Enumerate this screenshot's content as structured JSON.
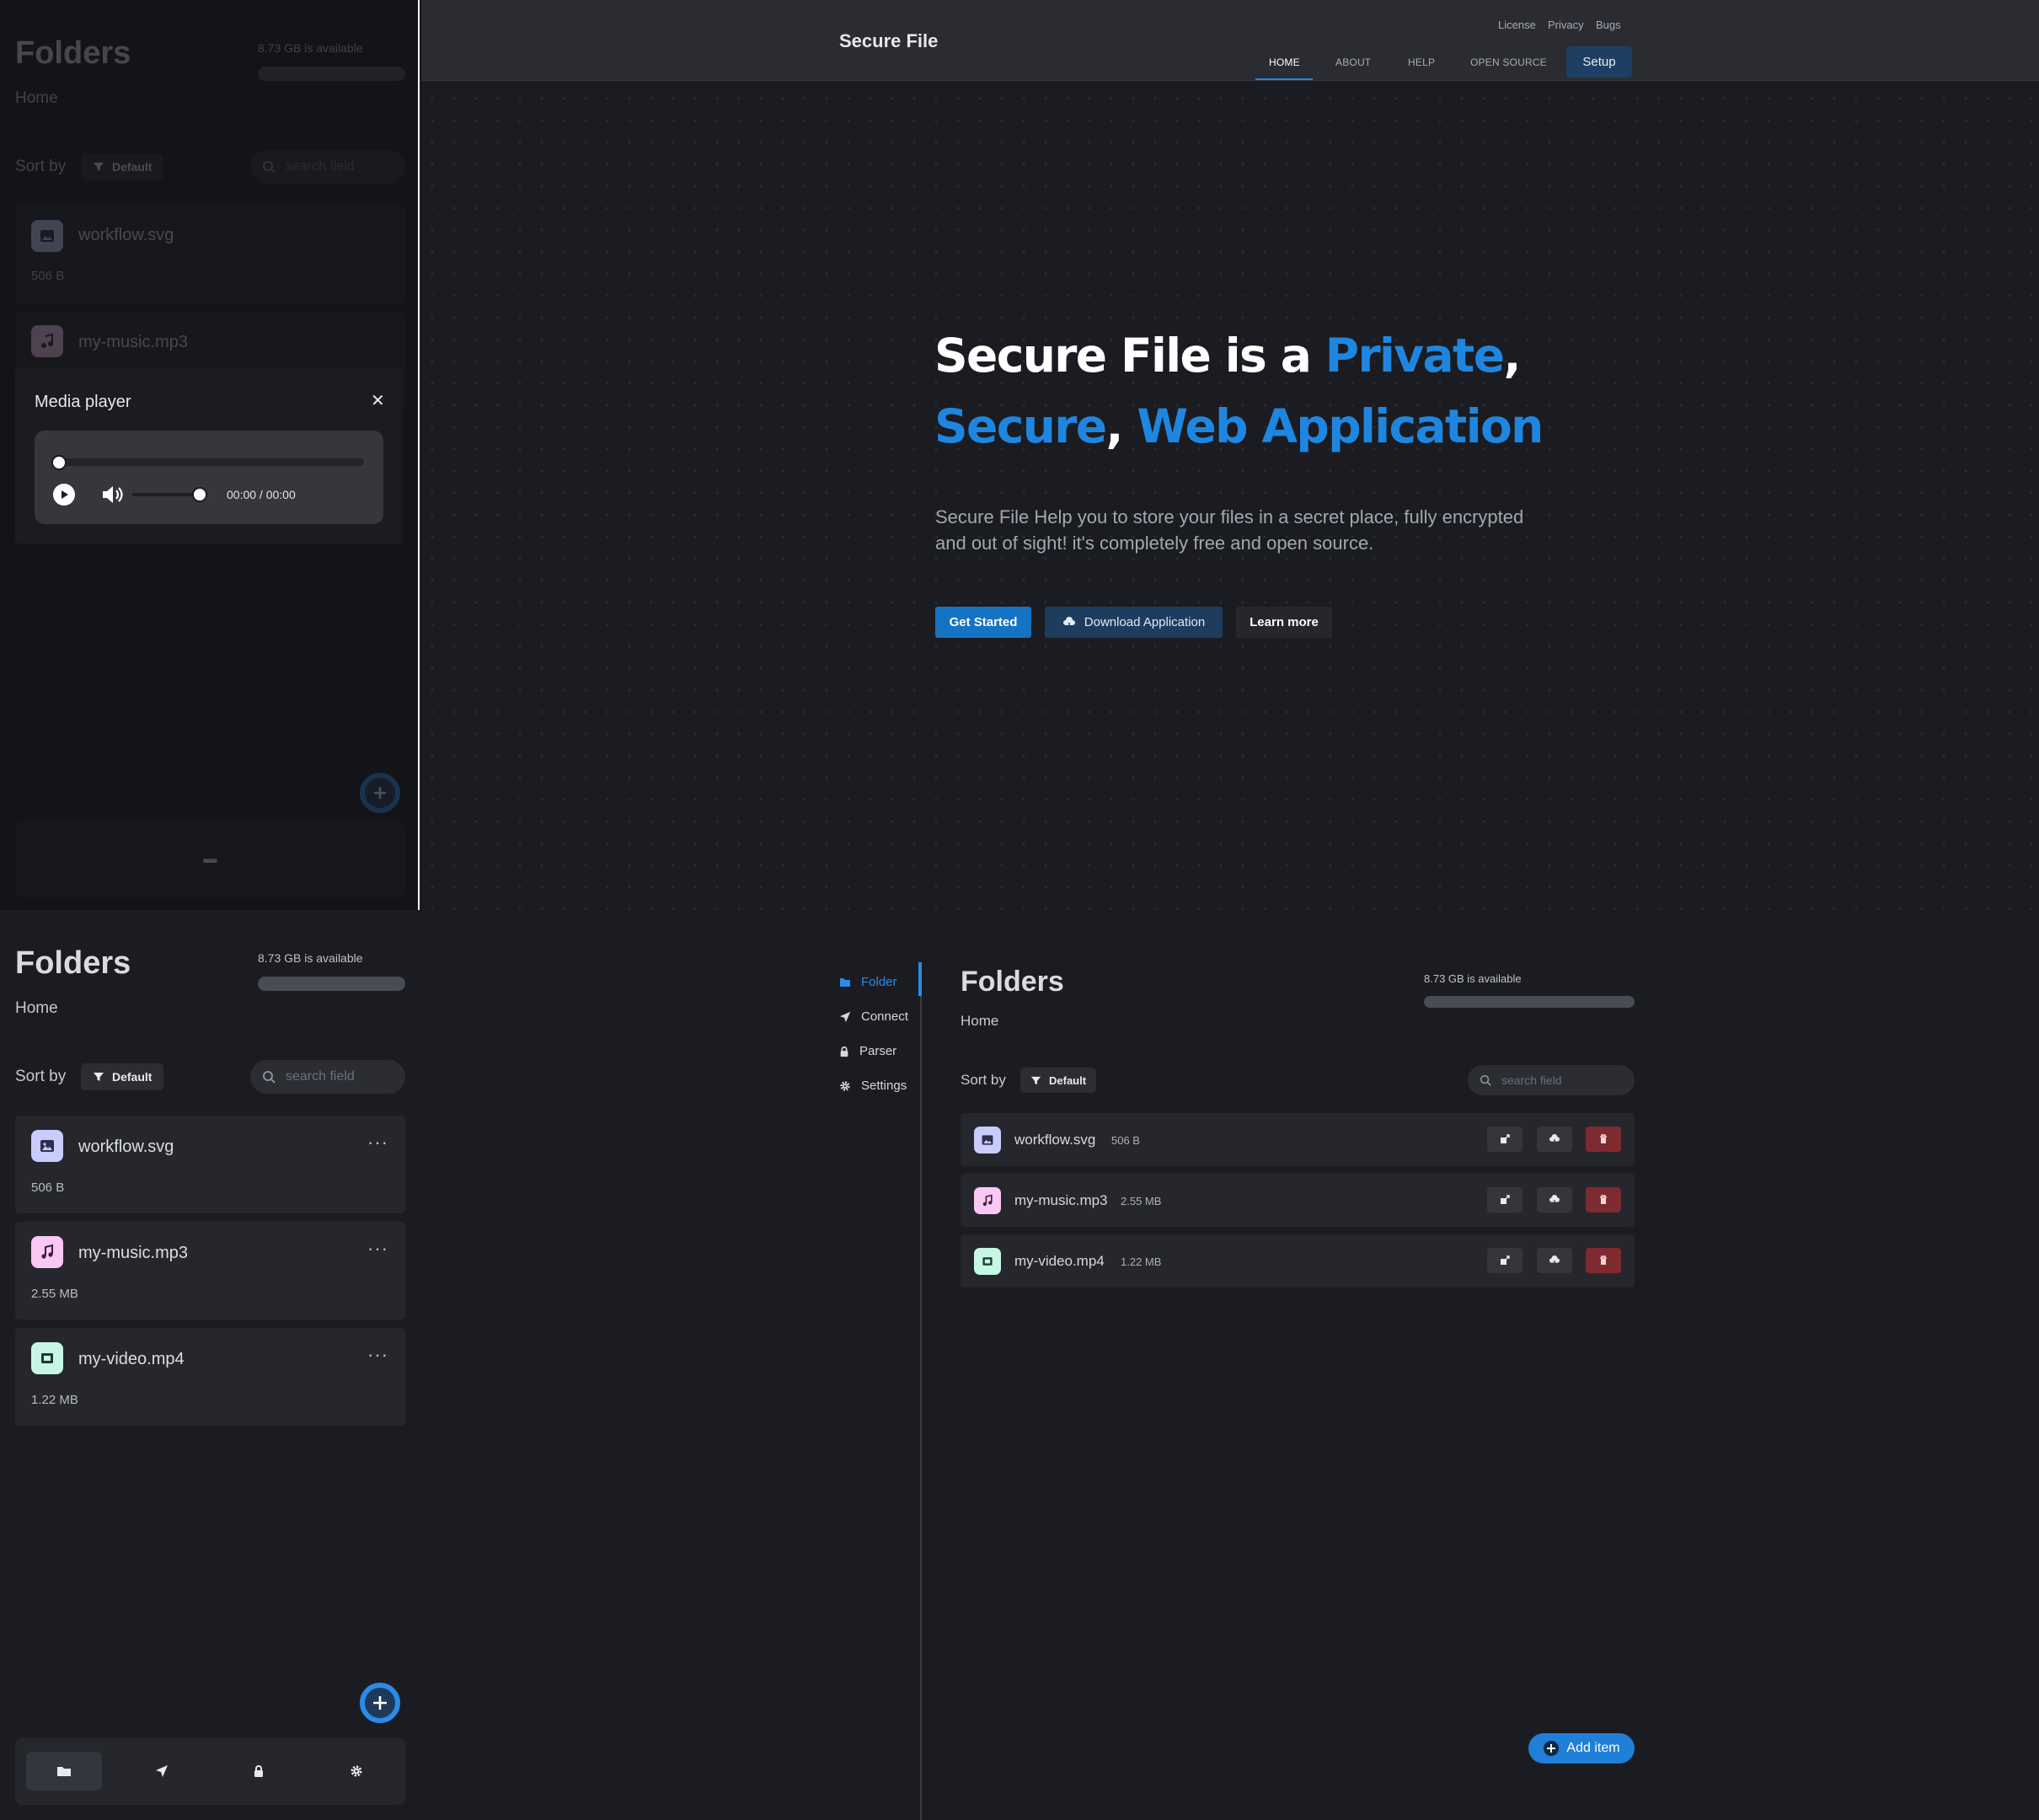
{
  "mobile": {
    "title": "Folders",
    "subtitle": "Home",
    "storage": {
      "available_text": "8.73 GB is available",
      "used_fraction": 0.0
    },
    "sort_label": "Sort by",
    "sort_value": "Default",
    "search_placeholder": "search field",
    "files": [
      {
        "name": "workflow.svg",
        "size": "506 B",
        "icon": "image-icon"
      },
      {
        "name": "my-music.mp3",
        "size": "2.55 MB",
        "icon": "music-icon"
      },
      {
        "name": "my-video.mp4",
        "size": "1.22 MB",
        "icon": "film-icon"
      }
    ],
    "more_label": "···",
    "nav": [
      "folder-icon",
      "send-icon",
      "lock-icon",
      "gear-icon"
    ]
  },
  "media_player": {
    "title": "Media player",
    "close": "✕",
    "time": "00:00 / 00:00",
    "progress": 0.0,
    "volume": 1.0
  },
  "site": {
    "brand": "Secure File",
    "top_links": [
      "License",
      "Privacy",
      "Bugs"
    ],
    "nav": [
      "HOME",
      "ABOUT",
      "HELP",
      "OPEN SOURCE"
    ],
    "setup": "Setup",
    "hero": {
      "line1_a": "Secure File is a ",
      "line1_b": "Private",
      "line1_c": ",",
      "line2_a": "Secure",
      "line2_b": ", ",
      "line2_c": "Web Application",
      "p1": "Secure File Help you to store your files in a secret place, fully encrypted",
      "p2": "and out of sight! it's completely free and open source."
    },
    "buttons": {
      "get_started": "Get Started",
      "download": "Download Application",
      "learn": "Learn more"
    }
  },
  "desktop": {
    "sidebar": [
      "Folder",
      "Connect",
      "Parser",
      "Settings"
    ],
    "title": "Folders",
    "subtitle": "Home",
    "available_text": "8.73 GB is available",
    "sort_label": "Sort by",
    "sort_value": "Default",
    "search_placeholder": "search field",
    "files": [
      {
        "name": "workflow.svg",
        "size": "506 B"
      },
      {
        "name": "my-music.mp3",
        "size": "2.55 MB"
      },
      {
        "name": "my-video.mp4",
        "size": "1.22 MB"
      }
    ],
    "add_item": "Add item"
  },
  "colors": {
    "accent": "#1f86e0",
    "background": "#1b1c21",
    "card": "#26272d",
    "danger": "#7d2a31"
  }
}
